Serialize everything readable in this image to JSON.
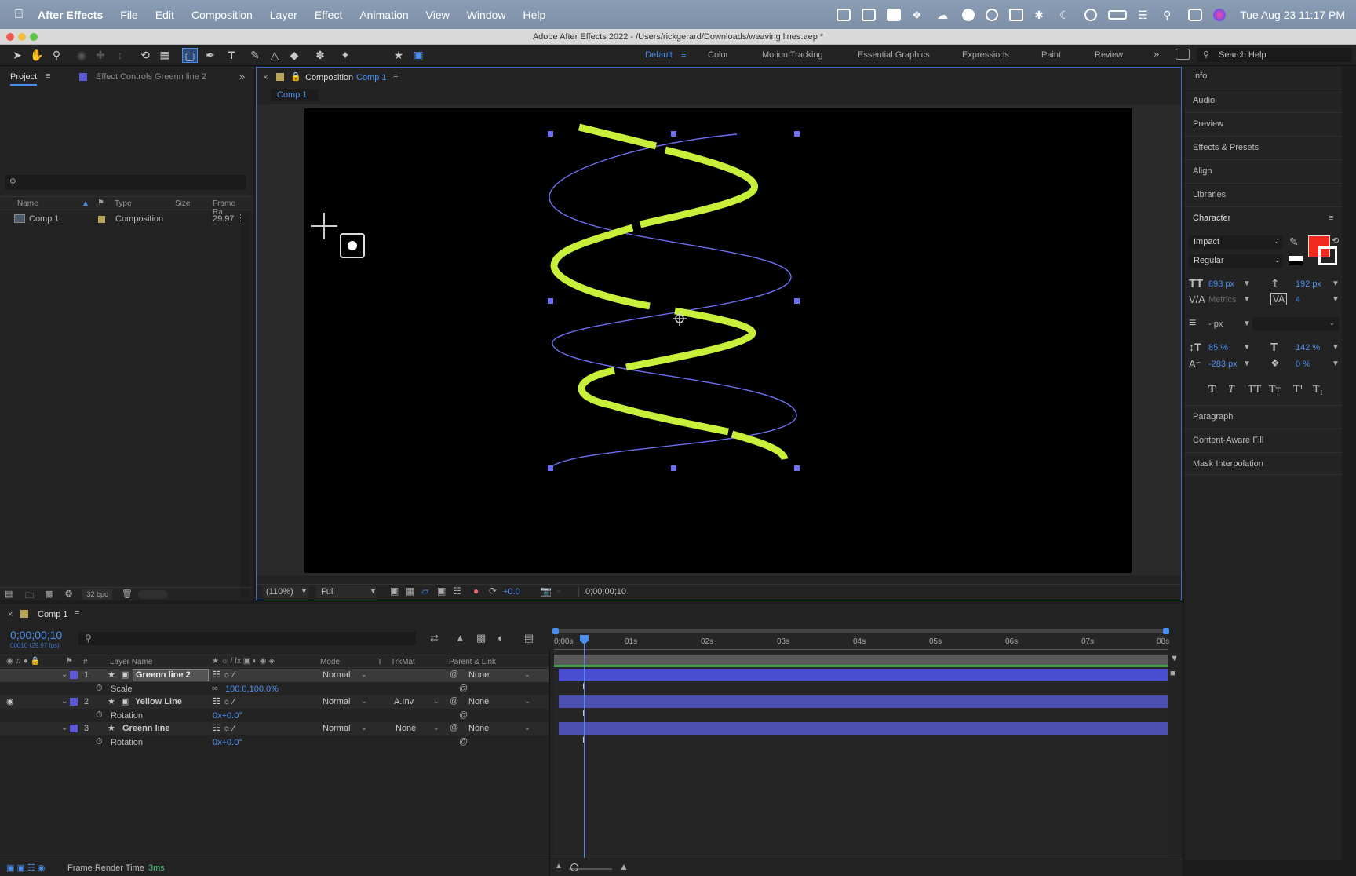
{
  "menubar": {
    "app": "After Effects",
    "items": [
      "File",
      "Edit",
      "Composition",
      "Layer",
      "Effect",
      "Animation",
      "View",
      "Window",
      "Help"
    ],
    "datetime": "Tue Aug 23  11:17 PM"
  },
  "window": {
    "title": "Adobe After Effects 2022 - /Users/rickgerard/Downloads/weaving lines.aep *"
  },
  "workspaces": [
    "Default",
    "Color",
    "Motion Tracking",
    "Essential Graphics",
    "Expressions",
    "Paint",
    "Review"
  ],
  "search_help": "Search Help",
  "project": {
    "tab": "Project",
    "effect_tab": "Effect Controls Greenn line 2",
    "columns": {
      "name": "Name",
      "type": "Type",
      "size": "Size",
      "frame_rate": "Frame Ra..."
    },
    "items": [
      {
        "name": "Comp 1",
        "type": "Composition",
        "frame_rate": "29.97"
      }
    ],
    "bpc": "32 bpc"
  },
  "composition": {
    "tab_label": "Composition",
    "tab_comp": "Comp 1",
    "subtab": "Comp 1",
    "zoom": "(110%)",
    "resolution": "Full",
    "exposure": "+0.0",
    "timecode": "0;00;00;10"
  },
  "right_panel": {
    "items": [
      "Info",
      "Audio",
      "Preview",
      "Effects & Presets",
      "Align",
      "Libraries"
    ],
    "character_title": "Character",
    "lower_items": [
      "Paragraph",
      "Content-Aware Fill",
      "Mask Interpolation"
    ]
  },
  "character": {
    "font": "Impact",
    "style": "Regular",
    "size": "893 px",
    "leading": "192 px",
    "kerning": "Metrics",
    "tracking": "4",
    "stroke": "- px",
    "vscale": "85 %",
    "hscale": "142 %",
    "baseline": "-283 px",
    "tsume": "0 %",
    "fill_color": "#f02a1e",
    "styles": [
      "T",
      "T",
      "TT",
      "Tт",
      "T¹",
      "T₁"
    ]
  },
  "timeline": {
    "tab": "Comp 1",
    "timecode": "0;00;00;10",
    "fps": "00010 (29.97 fps)",
    "columns": {
      "num": "#",
      "layer_name": "Layer Name",
      "mode": "Mode",
      "t": "T",
      "trkmat": "TrkMat",
      "parent": "Parent & Link"
    },
    "ruler": [
      "0:00s",
      "01s",
      "02s",
      "03s",
      "04s",
      "05s",
      "06s",
      "07s",
      "08s"
    ],
    "layers": [
      {
        "num": "1",
        "name": "Greenn line 2",
        "mode": "Normal",
        "trkmat": "",
        "parent": "None",
        "prop": "Scale",
        "prop_value": "100.0,100.0%"
      },
      {
        "num": "2",
        "name": "Yellow Line",
        "mode": "Normal",
        "trkmat": "A.Inv",
        "parent": "None",
        "prop": "Rotation",
        "prop_value": "0x+0.0°"
      },
      {
        "num": "3",
        "name": "Greenn line",
        "mode": "Normal",
        "trkmat": "None",
        "parent": "None",
        "prop": "Rotation",
        "prop_value": "0x+0.0°"
      }
    ],
    "render_label": "Frame Render Time",
    "render_value": "3ms"
  },
  "colors": {
    "accent": "#4a8ff0",
    "green_line": "#c8f03a",
    "blue_line": "#6b6ff0",
    "layer_label": "#5a5ad8"
  }
}
